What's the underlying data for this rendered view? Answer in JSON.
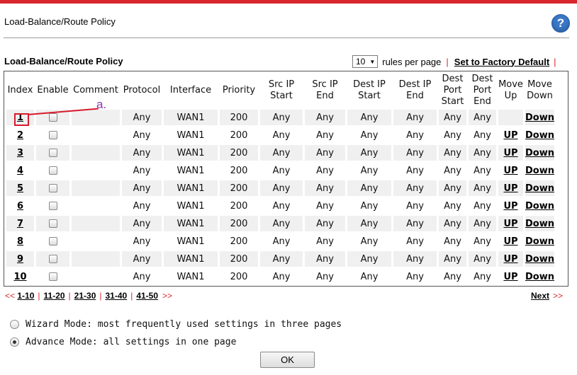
{
  "page": {
    "title": "Load-Balance/Route Policy",
    "help_glyph": "?",
    "section_title": "Load-Balance/Route Policy"
  },
  "rules_per_page": {
    "value": "10",
    "label": "rules per page",
    "separator": "|",
    "factory_default_label": "Set to Factory Default",
    "trailing_separator": "|"
  },
  "table": {
    "headers": [
      "Index",
      "Enable",
      "Comment",
      "Protocol",
      "Interface",
      "Priority",
      "Src IP Start",
      "Src IP End",
      "Dest IP Start",
      "Dest IP End",
      "Dest Port Start",
      "Dest Port End",
      "Move Up",
      "Move Down"
    ],
    "rows": [
      {
        "index": "1",
        "protocol": "Any",
        "interface": "WAN1",
        "priority": "200",
        "src_start": "Any",
        "src_end": "Any",
        "dest_start": "Any",
        "dest_end": "Any",
        "port_start": "Any",
        "port_end": "Any",
        "up": "",
        "down": "Down"
      },
      {
        "index": "2",
        "protocol": "Any",
        "interface": "WAN1",
        "priority": "200",
        "src_start": "Any",
        "src_end": "Any",
        "dest_start": "Any",
        "dest_end": "Any",
        "port_start": "Any",
        "port_end": "Any",
        "up": "UP",
        "down": "Down"
      },
      {
        "index": "3",
        "protocol": "Any",
        "interface": "WAN1",
        "priority": "200",
        "src_start": "Any",
        "src_end": "Any",
        "dest_start": "Any",
        "dest_end": "Any",
        "port_start": "Any",
        "port_end": "Any",
        "up": "UP",
        "down": "Down"
      },
      {
        "index": "4",
        "protocol": "Any",
        "interface": "WAN1",
        "priority": "200",
        "src_start": "Any",
        "src_end": "Any",
        "dest_start": "Any",
        "dest_end": "Any",
        "port_start": "Any",
        "port_end": "Any",
        "up": "UP",
        "down": "Down"
      },
      {
        "index": "5",
        "protocol": "Any",
        "interface": "WAN1",
        "priority": "200",
        "src_start": "Any",
        "src_end": "Any",
        "dest_start": "Any",
        "dest_end": "Any",
        "port_start": "Any",
        "port_end": "Any",
        "up": "UP",
        "down": "Down"
      },
      {
        "index": "6",
        "protocol": "Any",
        "interface": "WAN1",
        "priority": "200",
        "src_start": "Any",
        "src_end": "Any",
        "dest_start": "Any",
        "dest_end": "Any",
        "port_start": "Any",
        "port_end": "Any",
        "up": "UP",
        "down": "Down"
      },
      {
        "index": "7",
        "protocol": "Any",
        "interface": "WAN1",
        "priority": "200",
        "src_start": "Any",
        "src_end": "Any",
        "dest_start": "Any",
        "dest_end": "Any",
        "port_start": "Any",
        "port_end": "Any",
        "up": "UP",
        "down": "Down"
      },
      {
        "index": "8",
        "protocol": "Any",
        "interface": "WAN1",
        "priority": "200",
        "src_start": "Any",
        "src_end": "Any",
        "dest_start": "Any",
        "dest_end": "Any",
        "port_start": "Any",
        "port_end": "Any",
        "up": "UP",
        "down": "Down"
      },
      {
        "index": "9",
        "protocol": "Any",
        "interface": "WAN1",
        "priority": "200",
        "src_start": "Any",
        "src_end": "Any",
        "dest_start": "Any",
        "dest_end": "Any",
        "port_start": "Any",
        "port_end": "Any",
        "up": "UP",
        "down": "Down"
      },
      {
        "index": "10",
        "protocol": "Any",
        "interface": "WAN1",
        "priority": "200",
        "src_start": "Any",
        "src_end": "Any",
        "dest_start": "Any",
        "dest_end": "Any",
        "port_start": "Any",
        "port_end": "Any",
        "up": "UP",
        "down": "Down"
      }
    ]
  },
  "annotation": {
    "label": "a."
  },
  "pager": {
    "prev": "<<",
    "pages": [
      "1-10",
      "11-20",
      "21-30",
      "31-40",
      "41-50"
    ],
    "separator": "|",
    "more": ">>",
    "next_label": "Next",
    "next_arrows": ">>"
  },
  "modes": {
    "wizard": {
      "label": "Wizard Mode: most frequently used settings in three pages",
      "selected": false
    },
    "advance": {
      "label": "Advance Mode: all settings in one page",
      "selected": true
    }
  },
  "ok_label": "OK",
  "colors": {
    "accent_red": "#d8262c",
    "annotation_red": "#d81a2c",
    "annotation_purple": "#8a3aa8",
    "row_shade": "#f0f0f0"
  }
}
